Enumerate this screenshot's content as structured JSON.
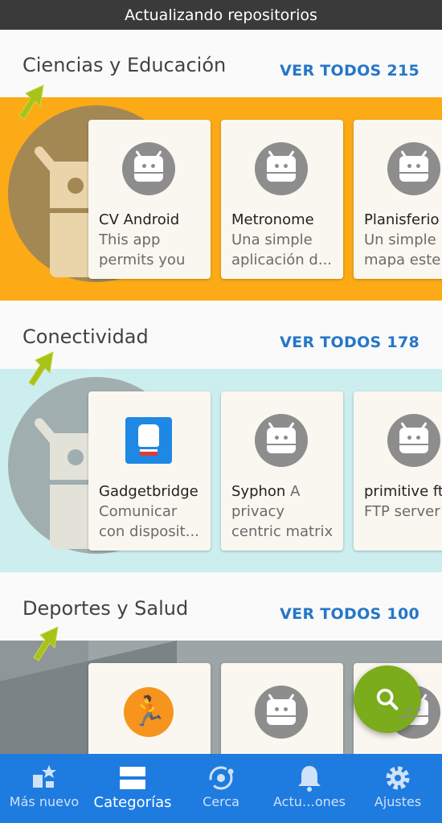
{
  "status": {
    "text": "Actualizando repositorios"
  },
  "sections": [
    {
      "title": "Ciencias y Educación",
      "see_all": "VER TODOS 215",
      "color": "#fcab16",
      "apps": [
        {
          "name": "CV Android",
          "desc": "This app permits you to ...",
          "icon": "android-robot-icon"
        },
        {
          "name": "Metronome",
          "desc": "Una simple aplicación d...",
          "icon": "android-robot-icon"
        },
        {
          "name": "Planisferio",
          "desc": "Un simple mapa este",
          "icon": "android-robot-icon"
        }
      ]
    },
    {
      "title": "Conectividad",
      "see_all": "VER TODOS 178",
      "color": "#cdeeef",
      "apps": [
        {
          "name": "Gadgetbridge",
          "desc": "Comunicar con disposit...",
          "icon": "gadgetbridge-icon"
        },
        {
          "name": "Syphon",
          "desc": "A privacy centric matrix client",
          "icon": "android-robot-icon"
        },
        {
          "name": "primitive ftpd",
          "desc": "FTP server",
          "icon": "android-robot-icon"
        }
      ]
    },
    {
      "title": "Deportes y Salud",
      "see_all": "VER TODOS 100",
      "color": "#8e9699",
      "apps": [
        {
          "name": "",
          "desc": "",
          "icon": "runner-icon"
        },
        {
          "name": "",
          "desc": "",
          "icon": "android-robot-icon"
        },
        {
          "name": "",
          "desc": "",
          "icon": "android-robot-icon"
        }
      ]
    }
  ],
  "fab": {
    "icon": "search-icon"
  },
  "nav": [
    {
      "label": "Más nuevo",
      "icon": "whats-new-icon",
      "active": false
    },
    {
      "label": "Categorías",
      "icon": "categories-icon",
      "active": true
    },
    {
      "label": "Cerca",
      "icon": "nearby-icon",
      "active": false
    },
    {
      "label": "Actu…ones",
      "icon": "bell-icon",
      "active": false
    },
    {
      "label": "Ajustes",
      "icon": "settings-gear-icon",
      "active": false
    }
  ]
}
